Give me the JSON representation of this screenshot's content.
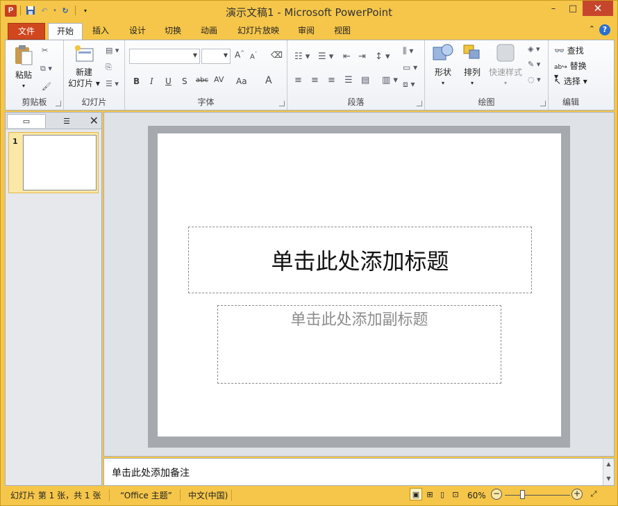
{
  "window": {
    "title": "演示文稿1 - Microsoft PowerPoint",
    "app_icon_letter": "P",
    "controls": {
      "minimize": "–",
      "maximize": "□",
      "close": "✕"
    }
  },
  "ribbon_tabs": [
    {
      "label": "文件"
    },
    {
      "label": "开始"
    },
    {
      "label": "插入"
    },
    {
      "label": "设计"
    },
    {
      "label": "切换"
    },
    {
      "label": "动画"
    },
    {
      "label": "幻灯片放映"
    },
    {
      "label": "审阅"
    },
    {
      "label": "视图"
    }
  ],
  "groups": {
    "clipboard": {
      "label": "剪贴板",
      "paste": "粘贴"
    },
    "slides": {
      "label": "幻灯片",
      "new_slide_line1": "新建",
      "new_slide_line2": "幻灯片 ▾"
    },
    "font": {
      "label": "字体",
      "font_name": "",
      "font_size": ""
    },
    "paragraph": {
      "label": "段落"
    },
    "drawing": {
      "label": "绘图",
      "shapes": "形状",
      "arrange": "排列",
      "quick_styles": "快速样式"
    },
    "editing": {
      "label": "编辑",
      "find": "查找",
      "replace": "替换 ▾",
      "select": "选择 ▾"
    }
  },
  "font_buttons": [
    "B",
    "I",
    "U",
    "S",
    "abc",
    "AV",
    "Aa",
    "A"
  ],
  "left_panel": {
    "slide_number": "1"
  },
  "slide": {
    "title_placeholder": "单击此处添加标题",
    "subtitle_placeholder": "单击此处添加副标题"
  },
  "notes": {
    "placeholder": "单击此处添加备注"
  },
  "status_bar": {
    "slide_info": "幻灯片 第 1 张，共 1 张",
    "theme": "“Office 主题”",
    "language": "中文(中国)",
    "zoom": "60%"
  },
  "colors": {
    "frame": "#f5c64a",
    "file_tab": "#d0471f",
    "close_button": "#c7452d",
    "selected_thumb": "#fbe7a6"
  }
}
